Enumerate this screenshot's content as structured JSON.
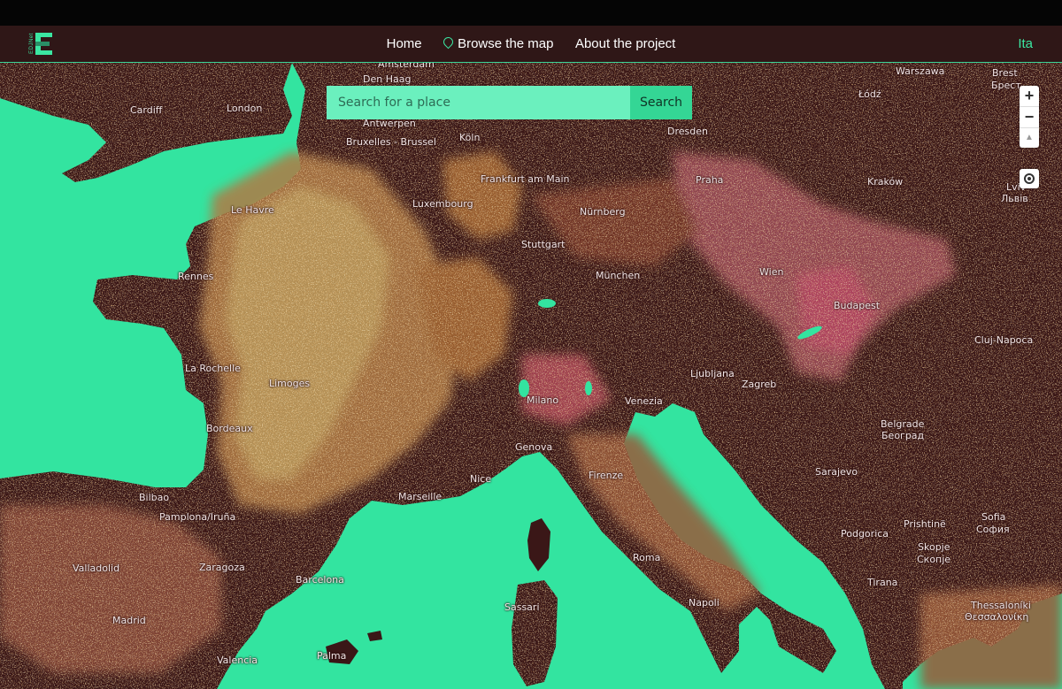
{
  "app": {
    "logo_text": "EDJNet",
    "lang": "Ita"
  },
  "nav": {
    "home": "Home",
    "browse": "Browse the map",
    "about": "About the project"
  },
  "search": {
    "placeholder": "Search for a place",
    "button": "Search"
  },
  "controls": {
    "zoom_in": "+",
    "zoom_out": "−",
    "reset": "▲"
  },
  "colors": {
    "sea": "#33e4a0",
    "land": "#3a1717",
    "dots_light": "#ecd48a",
    "dots_orange": "#e69a45",
    "dots_pink": "#e25573",
    "accent": "#3be6a1"
  },
  "cities": [
    {
      "name": "Amsterdam"
    },
    {
      "name": "Den Haag"
    },
    {
      "name": "Warszawa"
    },
    {
      "name": "Brest"
    },
    {
      "name": "Брест"
    },
    {
      "name": "Łódź"
    },
    {
      "name": "Cardiff"
    },
    {
      "name": "London"
    },
    {
      "name": "Antwerpen"
    },
    {
      "name": "Bruxelles - Brussel"
    },
    {
      "name": "Köln"
    },
    {
      "name": "Dresden"
    },
    {
      "name": "Frankfurt am Main"
    },
    {
      "name": "Praha"
    },
    {
      "name": "Kraków"
    },
    {
      "name": "Lviv"
    },
    {
      "name": "Львів"
    },
    {
      "name": "Le Havre"
    },
    {
      "name": "Luxembourg"
    },
    {
      "name": "Nürnberg"
    },
    {
      "name": "Stuttgart"
    },
    {
      "name": "Rennes"
    },
    {
      "name": "München"
    },
    {
      "name": "Wien"
    },
    {
      "name": "Budapest"
    },
    {
      "name": "Cluj-Napoca"
    },
    {
      "name": "La Rochelle"
    },
    {
      "name": "Limoges"
    },
    {
      "name": "Ljubljana"
    },
    {
      "name": "Zagreb"
    },
    {
      "name": "Milano"
    },
    {
      "name": "Venezia"
    },
    {
      "name": "Bordeaux"
    },
    {
      "name": "Belgrade"
    },
    {
      "name": "Београд"
    },
    {
      "name": "Genova"
    },
    {
      "name": "Sarajevo"
    },
    {
      "name": "Nice"
    },
    {
      "name": "Firenze"
    },
    {
      "name": "Bilbao"
    },
    {
      "name": "Marseille"
    },
    {
      "name": "Pamplona/Iruña"
    },
    {
      "name": "Sofia"
    },
    {
      "name": "София"
    },
    {
      "name": "Prishtinë"
    },
    {
      "name": "Podgorica"
    },
    {
      "name": "Skopje"
    },
    {
      "name": "Скопје"
    },
    {
      "name": "Valladolid"
    },
    {
      "name": "Zaragoza"
    },
    {
      "name": "Roma"
    },
    {
      "name": "Barcelona"
    },
    {
      "name": "Tirana"
    },
    {
      "name": "Sassari"
    },
    {
      "name": "Napoli"
    },
    {
      "name": "Madrid"
    },
    {
      "name": "Palma"
    },
    {
      "name": "Valencia"
    },
    {
      "name": "Thessaloníki"
    },
    {
      "name": "Θεσσαλονίκη"
    }
  ]
}
